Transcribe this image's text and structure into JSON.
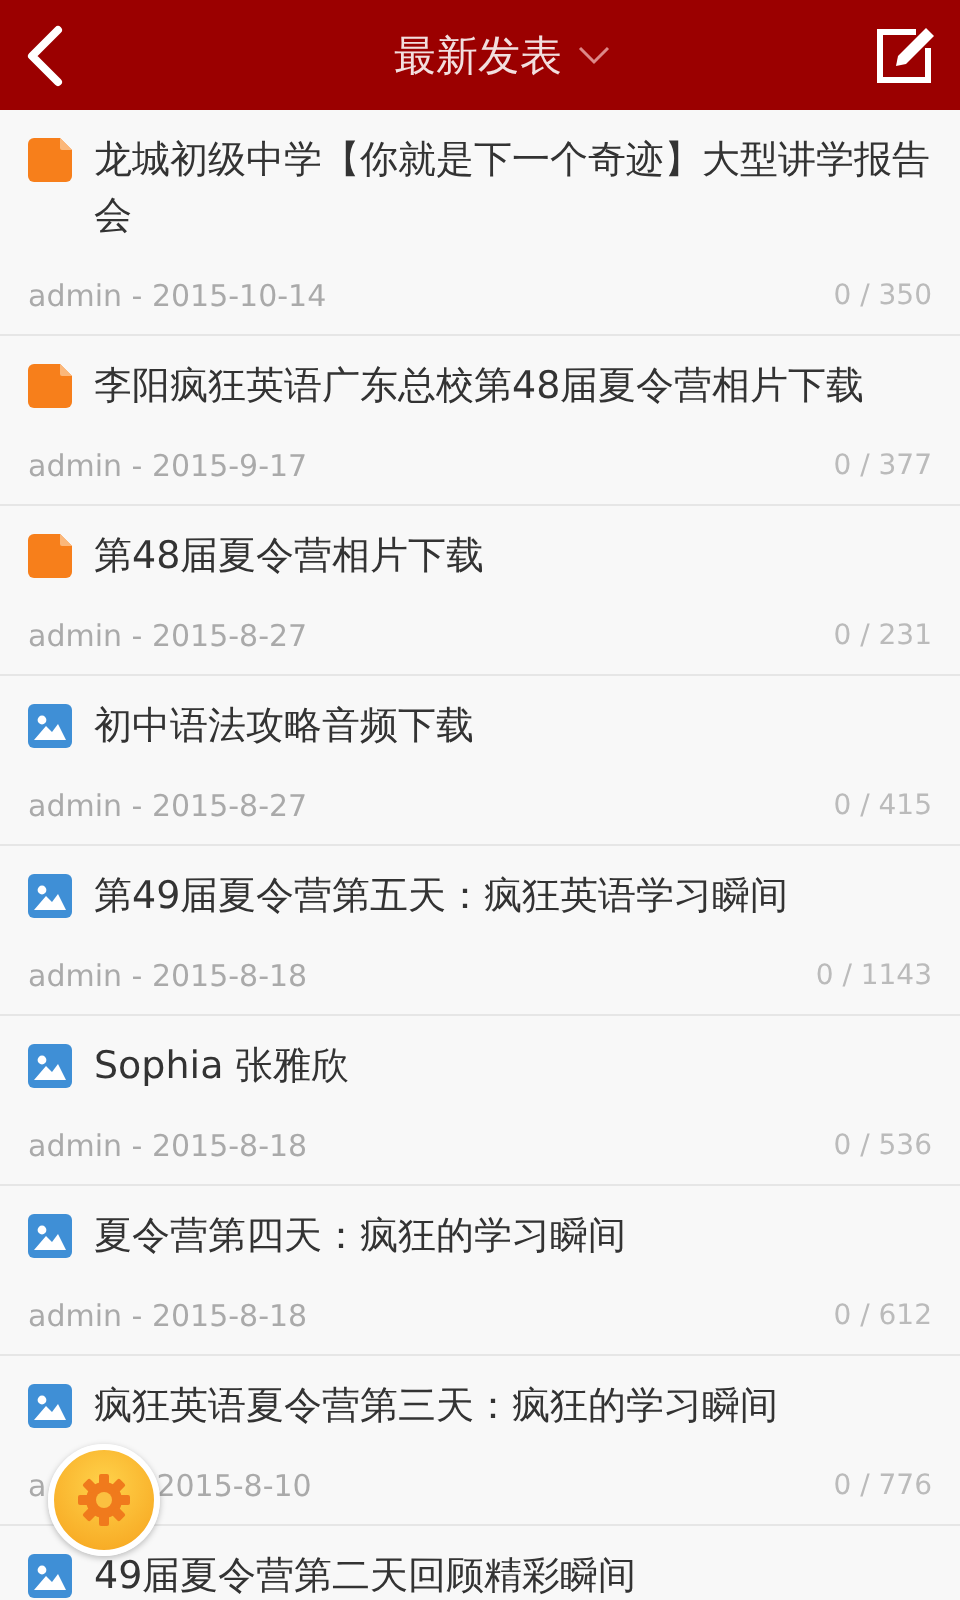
{
  "header": {
    "title": "最新发表"
  },
  "posts": [
    {
      "kind": "doc",
      "title": "龙城初级中学【你就是下一个奇迹】大型讲学报告会",
      "meta": "admin - 2015-10-14",
      "count": "0 / 350"
    },
    {
      "kind": "doc",
      "title": "李阳疯狂英语广东总校第48届夏令营相片下载",
      "meta": "admin - 2015-9-17",
      "count": "0 / 377"
    },
    {
      "kind": "doc",
      "title": "第48届夏令营相片下载",
      "meta": "admin - 2015-8-27",
      "count": "0 / 231"
    },
    {
      "kind": "image",
      "title": "初中语法攻略音频下载",
      "meta": "admin - 2015-8-27",
      "count": "0 / 415"
    },
    {
      "kind": "image",
      "title": "第49届夏令营第五天：疯狂英语学习瞬间",
      "meta": "admin - 2015-8-18",
      "count": "0 / 1143"
    },
    {
      "kind": "image",
      "title": "Sophia 张雅欣",
      "meta": "admin - 2015-8-18",
      "count": "0 / 536"
    },
    {
      "kind": "image",
      "title": "夏令营第四天：疯狂的学习瞬间",
      "meta": "admin - 2015-8-18",
      "count": "0 / 612"
    },
    {
      "kind": "image",
      "title": "疯狂英语夏令营第三天：疯狂的学习瞬间",
      "meta": "a",
      "meta_tail": "2015-8-10",
      "count": "0 / 776"
    },
    {
      "kind": "image",
      "title": "49届夏令营第二天回顾精彩瞬间"
    }
  ]
}
